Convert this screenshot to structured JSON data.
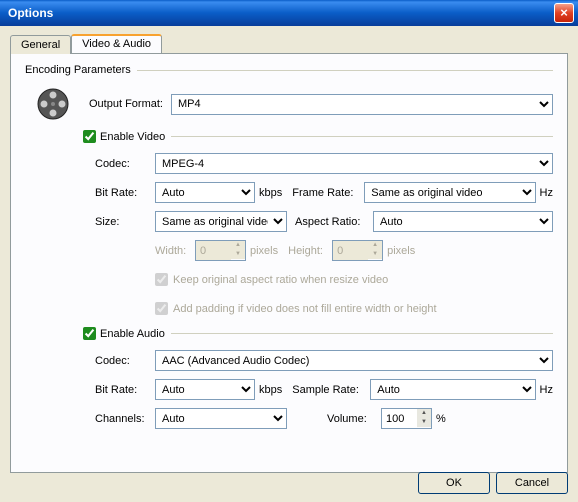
{
  "window": {
    "title": "Options"
  },
  "tabs": {
    "general": "General",
    "video_audio": "Video & Audio"
  },
  "fieldsets": {
    "encoding": "Encoding Parameters",
    "enable_video": "Enable Video",
    "enable_audio": "Enable Audio"
  },
  "video": {
    "output_format_label": "Output Format:",
    "output_format_value": "MP4",
    "codec_label": "Codec:",
    "codec_value": "MPEG-4",
    "bitrate_label": "Bit Rate:",
    "bitrate_value": "Auto",
    "bitrate_unit": "kbps",
    "framerate_label": "Frame Rate:",
    "framerate_value": "Same as original video",
    "framerate_unit": "Hz",
    "size_label": "Size:",
    "size_value": "Same as original video",
    "aspect_label": "Aspect Ratio:",
    "aspect_value": "Auto",
    "width_label": "Width:",
    "width_value": "0",
    "height_label": "Height:",
    "height_value": "0",
    "pixels_unit": "pixels",
    "keep_aspect": "Keep original aspect ratio when resize video",
    "add_padding": "Add padding if video does not fill entire width or height"
  },
  "audio": {
    "codec_label": "Codec:",
    "codec_value": "AAC (Advanced Audio Codec)",
    "bitrate_label": "Bit Rate:",
    "bitrate_value": "Auto",
    "bitrate_unit": "kbps",
    "samplerate_label": "Sample Rate:",
    "samplerate_value": "Auto",
    "samplerate_unit": "Hz",
    "channels_label": "Channels:",
    "channels_value": "Auto",
    "volume_label": "Volume:",
    "volume_value": "100",
    "volume_unit": "%"
  },
  "buttons": {
    "ok": "OK",
    "cancel": "Cancel"
  }
}
